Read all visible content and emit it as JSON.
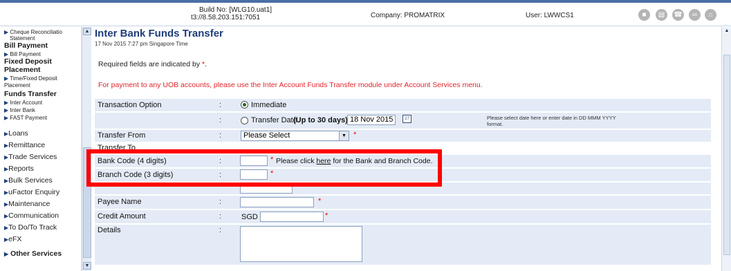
{
  "header": {
    "build_line1": "Build No: [WLG10.uat1]",
    "build_line2": "t3://8.58.203.151:7051",
    "company": "Company: PROMATRIX",
    "user": "User: LWWCS1",
    "icons": [
      "lock-icon",
      "print-icon",
      "phone-icon",
      "link-icon",
      "home-icon"
    ]
  },
  "sidebar": {
    "cheque": "Cheque Reconciliatio",
    "statement": "Statement",
    "bill_payment_header": "Bill Payment",
    "bill_payment": "Bill Payment",
    "fixed_deposit_header_1": "Fixed Deposit",
    "fixed_deposit_header_2": "Placement",
    "time_fixed_1": "Time/Fixed Deposit",
    "time_fixed_2": "Placement",
    "funds_transfer_header": "Funds Transfer",
    "inter_account": "Inter Account",
    "inter_bank": "Inter Bank",
    "fast_payment": "FAST Payment",
    "items": [
      "Loans",
      "Remittance",
      "Trade Services",
      "Reports",
      "Bulk Services",
      "uFactor Enquiry",
      "Maintenance",
      "Communication",
      "To Do/To Track",
      "eFX"
    ],
    "other": "Other Services"
  },
  "page": {
    "title": "Inter Bank Funds Transfer",
    "timestamp": "17 Nov 2015 7:27 pm Singapore Time",
    "required_note": "Required fields are indicated by",
    "star": "*",
    "period": ".",
    "notice": "For payment to any UOB accounts, please use the Inter Account Funds Transfer module under Account Services menu."
  },
  "form": {
    "colon": ":",
    "transaction_option_label": "Transaction Option",
    "immediate_label": "Immediate",
    "transfer_date_label": "Transfer Date",
    "transfer_date_hint": "(Up to 30 days)",
    "transfer_date_value": "18 Nov 2015",
    "date_help_1": "Please select date here or enter date in DD MMM YYYY",
    "date_help_2": "format.",
    "transfer_from_label": "Transfer From",
    "transfer_from_value": "Please Select",
    "transfer_to_label": "Transfer To",
    "bank_code_label": "Bank Code (4 digits)",
    "bank_code_help_pre": "Please click",
    "bank_code_help_link": "here",
    "bank_code_help_post": "for the Bank and Branch Code.",
    "branch_code_label": "Branch Code (3 digits)",
    "payee_name_label": "Payee Name",
    "credit_amount_label": "Credit Amount",
    "currency": "SGD",
    "details_label": "Details"
  },
  "colors": {
    "accent": "#1f3d7a",
    "row_bg": "#e4ebf6",
    "warning": "#e0242c",
    "highlight": "#ff0000"
  }
}
